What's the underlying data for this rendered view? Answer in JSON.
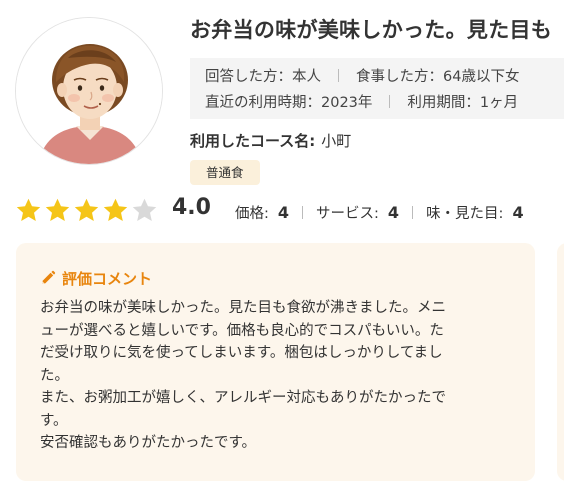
{
  "review": {
    "title": "お弁当の味が美味しかった。見た目も",
    "meta": {
      "responder_label": "回答した方：本人",
      "diner_label": "食事した方：64歳以下女",
      "last_used_label": "直近の利用時期：2023年",
      "period_label": "利用期間：1ヶ月"
    },
    "course": {
      "label": "利用したコース名:",
      "value": "小町"
    },
    "badge": "普通食",
    "rating": {
      "stars_filled": 4,
      "stars_total": 5,
      "score": "4.0",
      "price_label": "価格:",
      "price_value": "4",
      "service_label": "サービス:",
      "service_value": "4",
      "taste_label": "味・見た目:",
      "taste_value": "4"
    },
    "comment": {
      "heading": "評価コメント",
      "lines": [
        "お弁当の味が美味しかった。見た目も食欲が沸きました。メニ",
        "ューが選べると嬉しいです。価格も良心的でコスパもいい。た",
        "だ受け取りに気を使ってしまいます。梱包はしっかりしてまし",
        "た。",
        "また、お粥加工が嬉しく、アレルギー対応もありがたかったで",
        "す。",
        "安否確認もありがたかったです。"
      ]
    }
  },
  "icons": {
    "avatar": "woman-avatar-illustration",
    "stars": "star-icon",
    "comment": "pencil-icon"
  },
  "colors": {
    "star_filled": "#f5c518",
    "star_empty": "#d9d9d9",
    "accent": "#e8850e",
    "badge_bg": "#fbf0db",
    "comment_bg": "#fdf6ec",
    "meta_bg": "#f4f4f4"
  }
}
